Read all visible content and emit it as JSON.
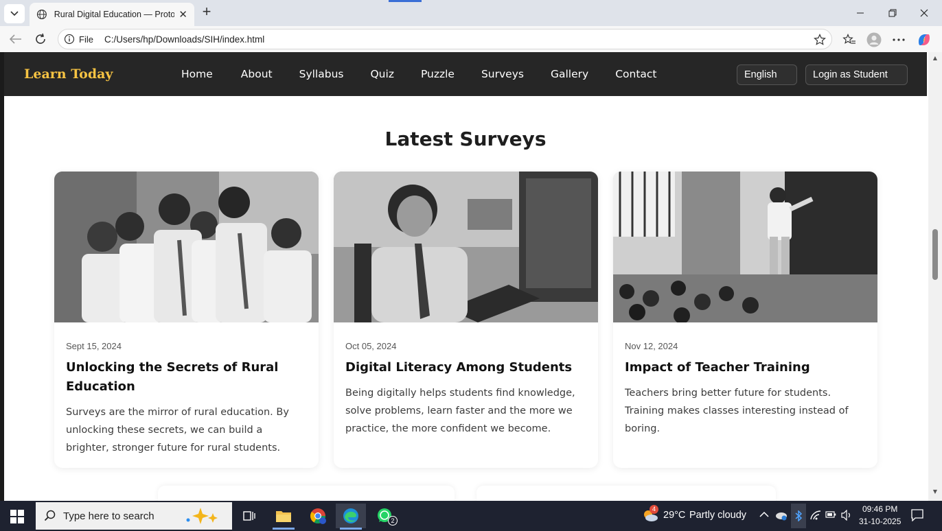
{
  "browser": {
    "tab_title": "Rural Digital Education — Prototy",
    "address_chip": "File",
    "url": "C:/Users/hp/Downloads/SIH/index.html"
  },
  "site": {
    "brand": "Learn Today",
    "menu": [
      "Home",
      "About",
      "Syllabus",
      "Quiz",
      "Puzzle",
      "Surveys",
      "Gallery",
      "Contact"
    ],
    "language_label": "English",
    "login_label": "Login as Student",
    "section_title": "Latest Surveys",
    "cards": [
      {
        "date": "Sept 15, 2024",
        "title": "Unlocking the Secrets of Rural Education",
        "text": "Surveys are the mirror of rural education. By unlocking these secrets, we can build a brighter, stronger future for rural students."
      },
      {
        "date": "Oct 05, 2024",
        "title": "Digital Literacy Among Students",
        "text": "Being digitally helps students find knowledge, solve problems, learn faster and the more we practice, the more confident we become."
      },
      {
        "date": "Nov 12, 2024",
        "title": "Impact of Teacher Training",
        "text": "Teachers bring better future for students. Training makes classes interesting instead of boring."
      }
    ]
  },
  "taskbar": {
    "search_placeholder": "Type here to search",
    "weather_temp": "29°C",
    "weather_desc": "Partly cloudy",
    "time": "09:46 PM",
    "date": "31-10-2025",
    "whatsapp_badge": "2",
    "weather_badge": "4"
  }
}
